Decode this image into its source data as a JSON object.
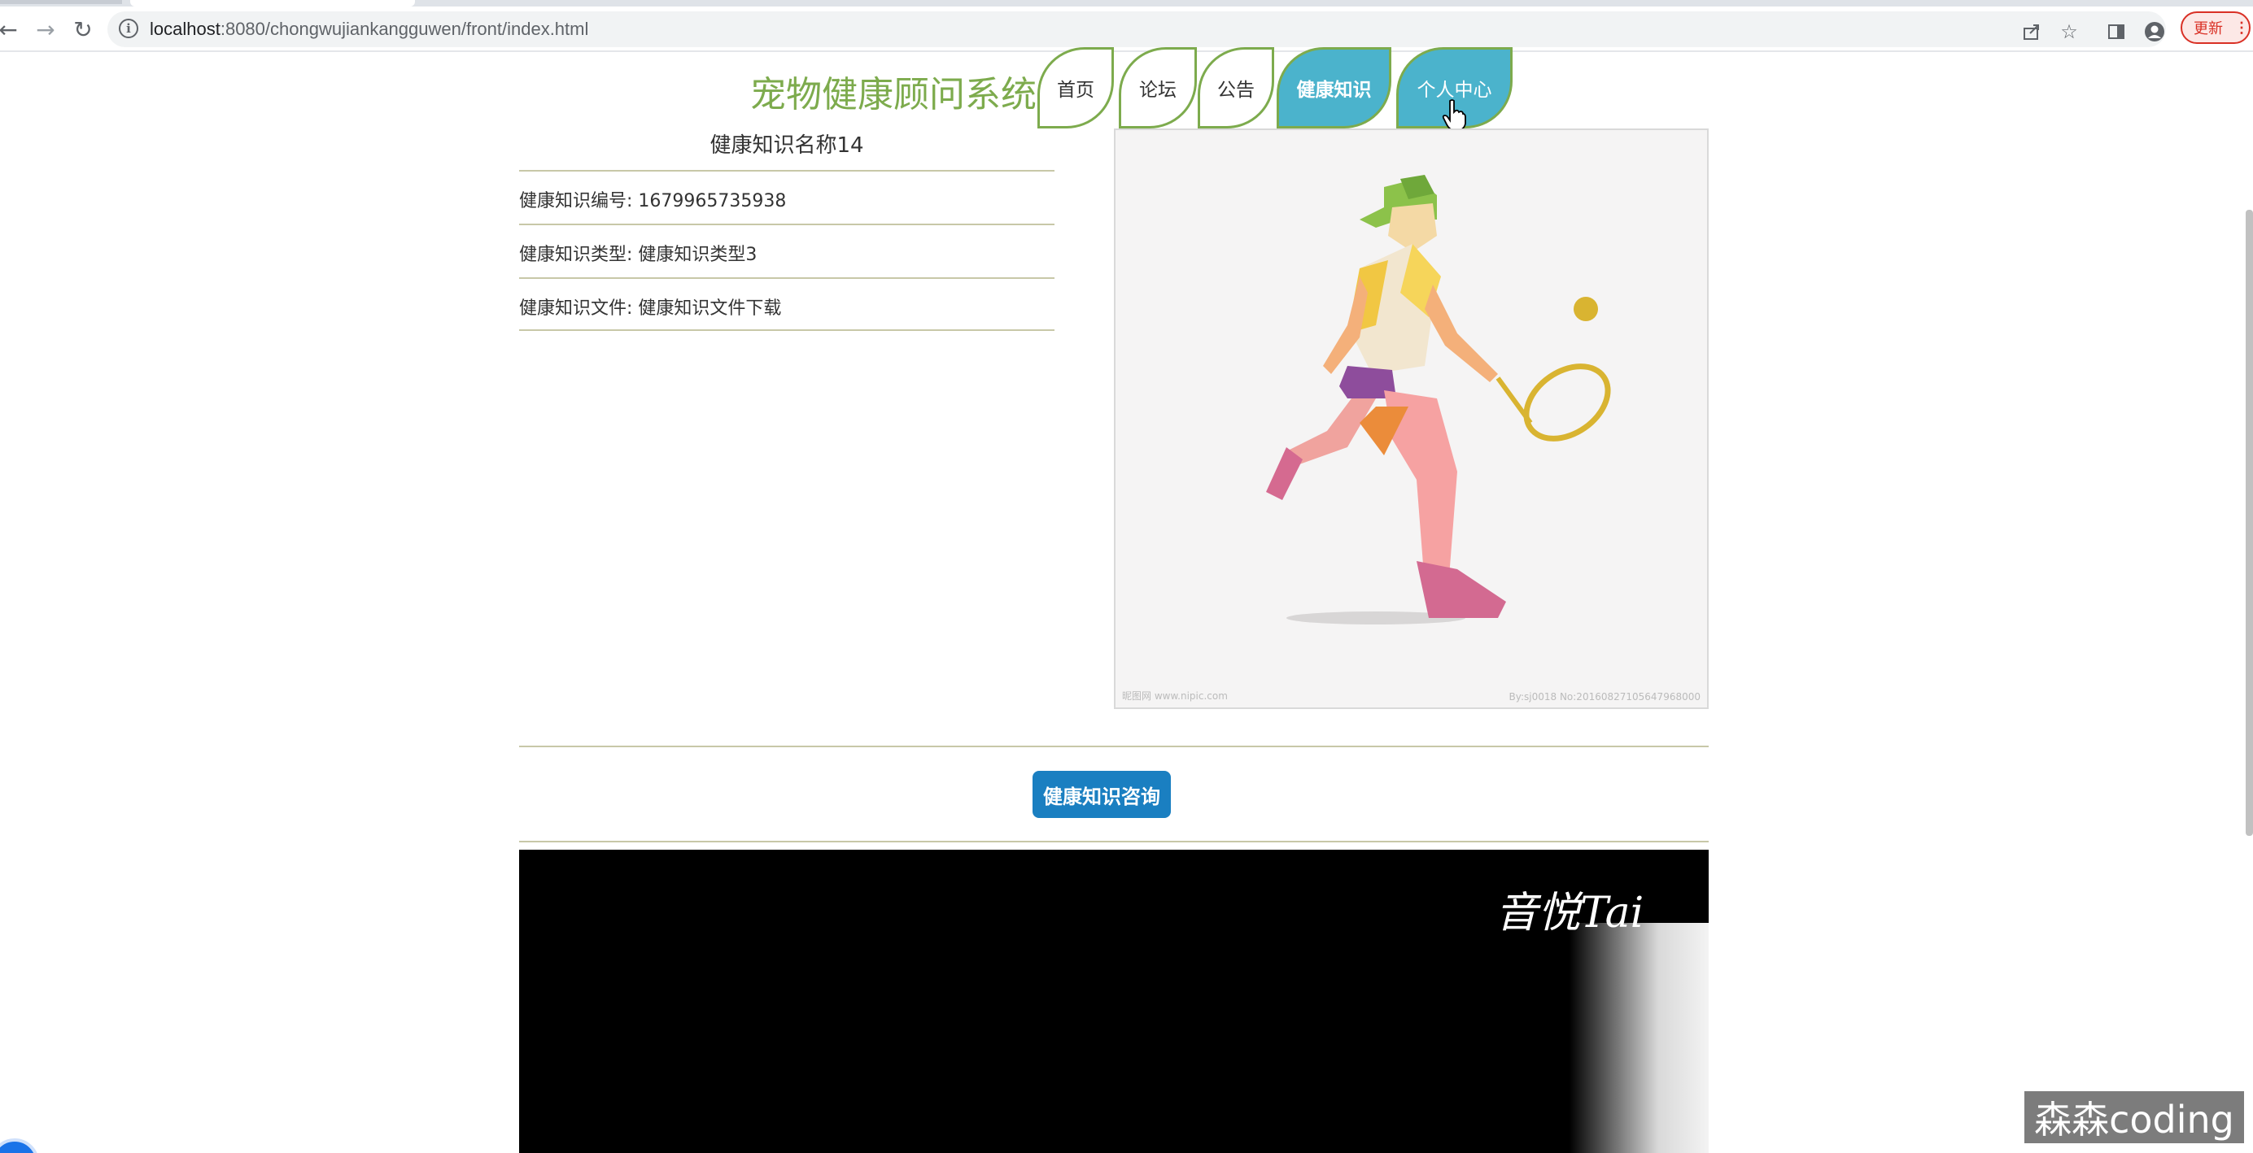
{
  "browser": {
    "url_host": "localhost",
    "url_rest": ":8080/chongwujiankangguwen/front/index.html",
    "update_label": "更新",
    "update_dots": "⋮",
    "back_icon": "arrow-left-icon",
    "forward_icon": "arrow-right-icon",
    "reload_icon": "reload-icon"
  },
  "header": {
    "title": "宠物健康顾问系统",
    "nav": [
      {
        "label": "首页",
        "active": false
      },
      {
        "label": "论坛",
        "active": false
      },
      {
        "label": "公告",
        "active": false
      },
      {
        "label": "健康知识",
        "active": true
      },
      {
        "label": "个人中心",
        "active": true
      }
    ]
  },
  "detail": {
    "name": "健康知识名称14",
    "fields": [
      {
        "label": "健康知识编号: 1679965735938"
      },
      {
        "label": "健康知识类型: 健康知识类型3"
      },
      {
        "label": "健康知识文件: 健康知识文件下载"
      }
    ],
    "image_watermark_left": "昵图网 www.nipic.com",
    "image_watermark_right": "By:sj0018 No:20160827105647968000"
  },
  "consult_button": "健康知识咨询",
  "video": {
    "caption": "音悦Tai"
  },
  "corner_badge": "森森coding",
  "colors": {
    "brand_green": "#7dab4d",
    "active_tab": "#4bb3cc",
    "button_blue": "#1a7fc1"
  }
}
